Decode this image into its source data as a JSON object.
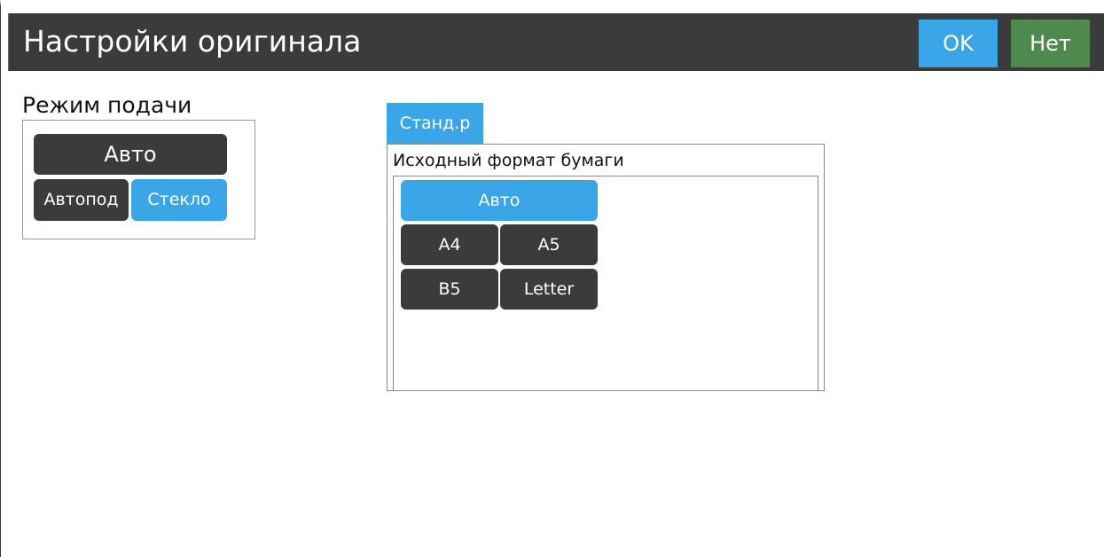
{
  "header": {
    "title": "Настройки оригинала",
    "ok_label": "OK",
    "no_label": "Нет"
  },
  "feed_mode": {
    "label": "Режим подачи",
    "auto_label": "Авто",
    "adf_label": "Автопод",
    "glass_label": "Стекло",
    "selected": "Стекло"
  },
  "original_size": {
    "tab_label": "Станд.р",
    "label": "Исходный формат бумаги",
    "options": [
      "Авто",
      "A4",
      "A5",
      "B5",
      "Letter"
    ],
    "selected": "Авто"
  },
  "colors": {
    "accent_blue": "#3aa6e8",
    "dark_button": "#3b3b3b",
    "cancel_green": "#4e8a4e",
    "title_bar": "#3b3b3b"
  }
}
